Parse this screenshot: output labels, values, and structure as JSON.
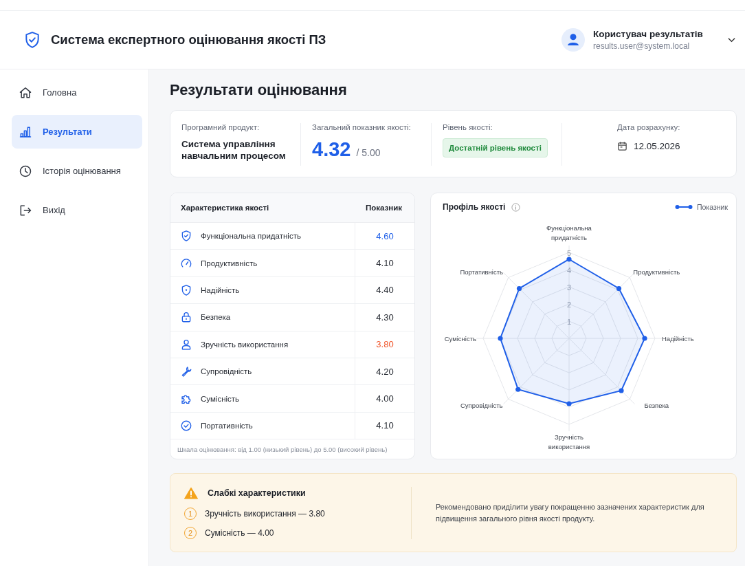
{
  "header": {
    "title": "Система експертного оцінювання якості ПЗ",
    "user": {
      "name": "Користувач результатів",
      "email": "results.user@system.local"
    }
  },
  "sidebar": {
    "items": [
      {
        "label": "Головна",
        "selected": false
      },
      {
        "label": "Результати",
        "selected": true
      },
      {
        "label": "Історія оцінювання",
        "selected": false
      },
      {
        "label": "Вихід",
        "selected": false
      }
    ]
  },
  "page_title": "Результати оцінювання",
  "summary": {
    "product": {
      "label": "Програмний продукт:",
      "value": "Система управління навчальним процесом"
    },
    "score": {
      "label": "Загальний показник якості:",
      "value": "4.32",
      "max": "/ 5.00"
    },
    "level": {
      "label": "Рівень якості:",
      "value": "Достатній рівень якості"
    },
    "date": {
      "label": "Дата розрахунку:",
      "value": "12.05.2026"
    }
  },
  "table": {
    "columns": [
      "Характеристика якості",
      "Показник"
    ],
    "rows": [
      {
        "name": "Функціональна придатність",
        "value": "4.60",
        "color": "#1f5fe8"
      },
      {
        "name": "Продуктивність",
        "value": "4.10",
        "color": "#272b33"
      },
      {
        "name": "Надійність",
        "value": "4.40",
        "color": "#272b33"
      },
      {
        "name": "Безпека",
        "value": "4.30",
        "color": "#272b33"
      },
      {
        "name": "Зручність використання",
        "value": "3.80",
        "color": "#f0552a"
      },
      {
        "name": "Супровідність",
        "value": "4.20",
        "color": "#272b33"
      },
      {
        "name": "Сумісність",
        "value": "4.00",
        "color": "#272b33"
      },
      {
        "name": "Портативність",
        "value": "4.10",
        "color": "#272b33"
      }
    ],
    "note": "Шкала оцінювання: від 1.00 (низький рівень) до 5.00 (високий рівень)"
  },
  "chart": {
    "chart_data": {
      "type": "radar",
      "title": "Профіль якості",
      "categories": [
        "Функціональна придатність",
        "Продуктивність",
        "Надійність",
        "Безпека",
        "Зручність використання",
        "Супровідність",
        "Сумісність",
        "Портативність"
      ],
      "series": [
        {
          "name": "Показник",
          "color": "#1f5fe8",
          "values": [
            4.6,
            4.1,
            4.4,
            4.3,
            3.8,
            4.2,
            4.0,
            4.1
          ]
        }
      ],
      "ylim": [
        0,
        5
      ],
      "yticks": [
        1,
        2,
        3,
        4,
        5
      ]
    }
  },
  "weak": {
    "title": "Слабкі характеристики",
    "items": [
      {
        "number": "1",
        "text": "Зручність використання — 3.80"
      },
      {
        "number": "2",
        "text": "Сумісність — 4.00"
      }
    ],
    "recommendation": "Рекомендовано приділити увагу покращенню зазначених характеристик для підвищення загального рівня якості продукту."
  }
}
